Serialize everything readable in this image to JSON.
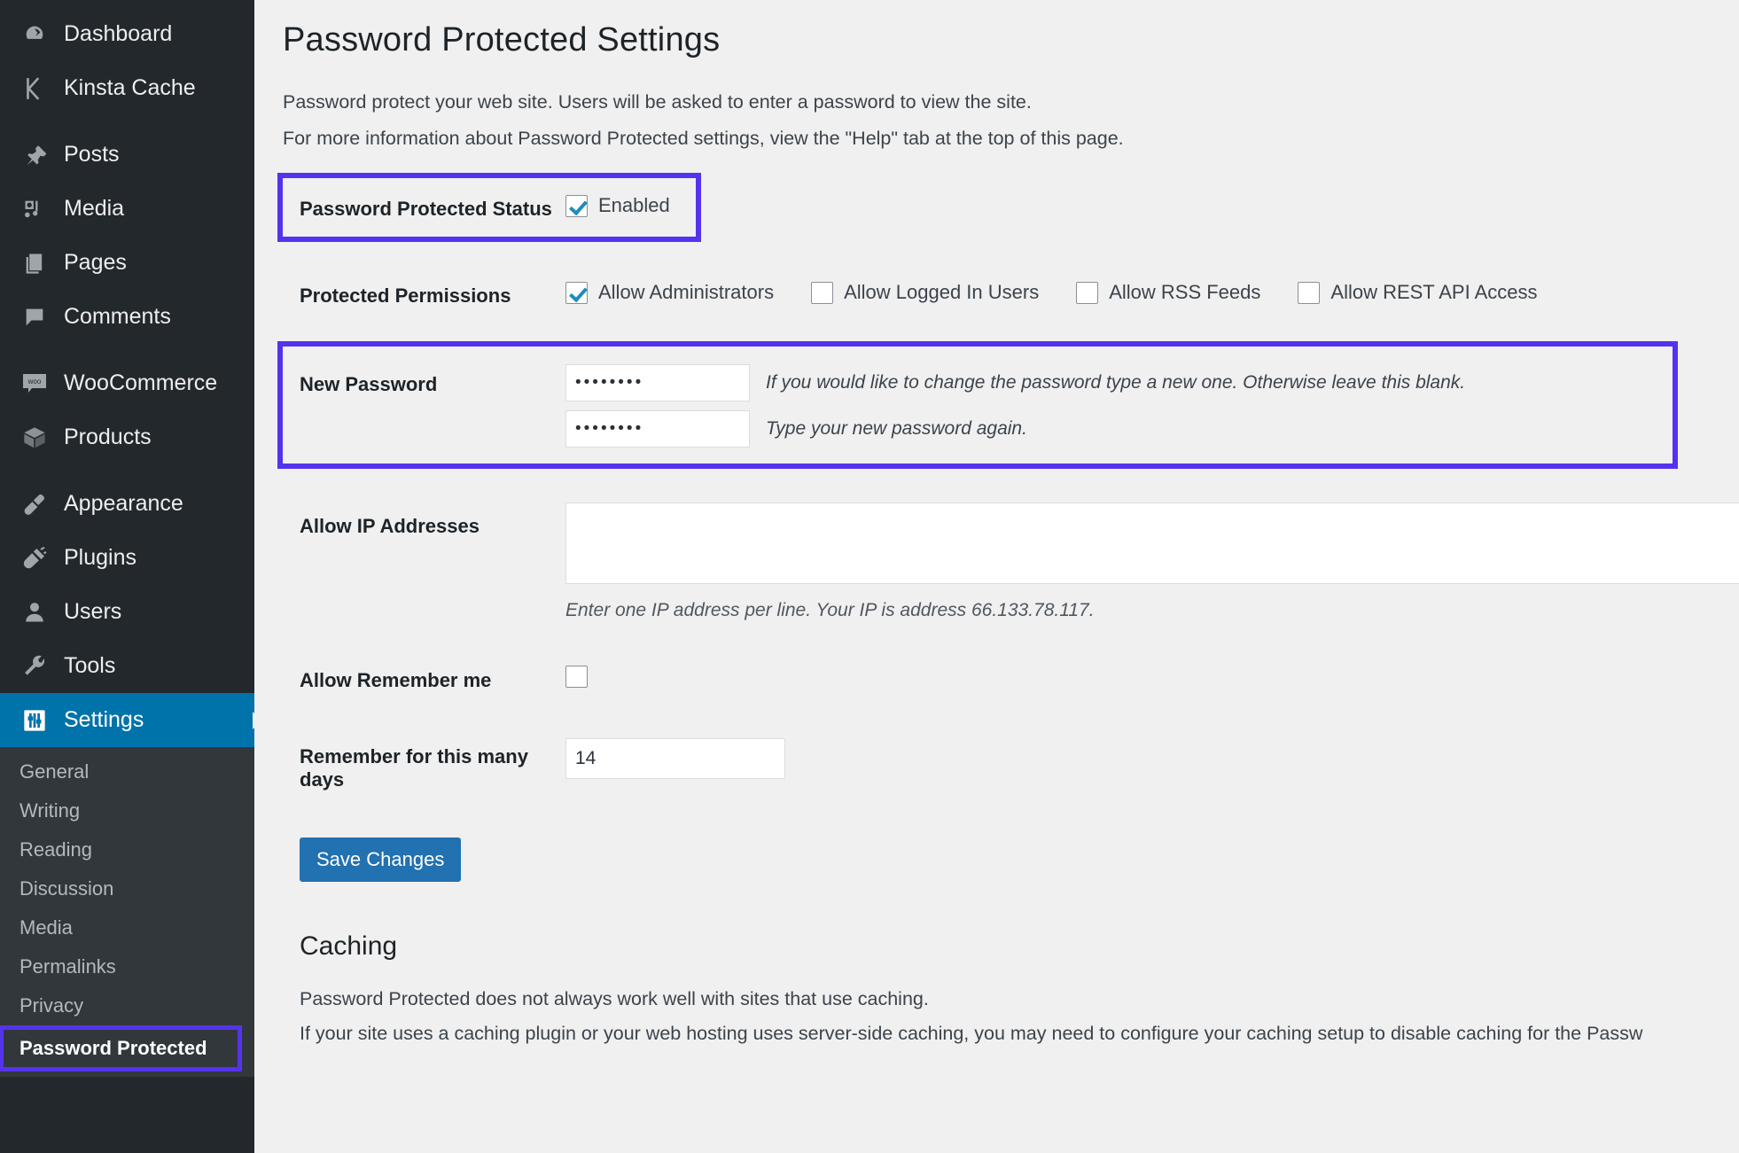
{
  "sidebar": {
    "items": [
      {
        "label": "Dashboard",
        "icon": "dashboard-icon"
      },
      {
        "label": "Kinsta Cache",
        "icon": "kinsta-k-icon"
      },
      {
        "label": "Posts",
        "icon": "pin-icon"
      },
      {
        "label": "Media",
        "icon": "media-icon"
      },
      {
        "label": "Pages",
        "icon": "pages-icon"
      },
      {
        "label": "Comments",
        "icon": "comment-bubble-icon"
      },
      {
        "label": "WooCommerce",
        "icon": "woocommerce-icon"
      },
      {
        "label": "Products",
        "icon": "box-icon"
      },
      {
        "label": "Appearance",
        "icon": "paintbrush-icon"
      },
      {
        "label": "Plugins",
        "icon": "plug-icon"
      },
      {
        "label": "Users",
        "icon": "user-icon"
      },
      {
        "label": "Tools",
        "icon": "wrench-icon"
      },
      {
        "label": "Settings",
        "icon": "settings-sliders-icon"
      }
    ],
    "submenu": [
      {
        "label": "General"
      },
      {
        "label": "Writing"
      },
      {
        "label": "Reading"
      },
      {
        "label": "Discussion"
      },
      {
        "label": "Media"
      },
      {
        "label": "Permalinks"
      },
      {
        "label": "Privacy"
      },
      {
        "label": "Password Protected"
      }
    ]
  },
  "page": {
    "title": "Password Protected Settings",
    "intro_line_1": "Password protect your web site. Users will be asked to enter a password to view the site.",
    "intro_line_2": "For more information about Password Protected settings, view the \"Help\" tab at the top of this page."
  },
  "form": {
    "status": {
      "label": "Password Protected Status",
      "checkbox_label": "Enabled",
      "checked": true
    },
    "permissions": {
      "label": "Protected Permissions",
      "options": [
        {
          "label": "Allow Administrators",
          "checked": true
        },
        {
          "label": "Allow Logged In Users",
          "checked": false
        },
        {
          "label": "Allow RSS Feeds",
          "checked": false
        },
        {
          "label": "Allow REST API Access",
          "checked": false
        }
      ]
    },
    "new_password": {
      "label": "New Password",
      "value_masked": "••••••••",
      "confirm_masked": "••••••••",
      "hint_1": "If you would like to change the password type a new one. Otherwise leave this blank.",
      "hint_2": "Type your new password again."
    },
    "allow_ip": {
      "label": "Allow IP Addresses",
      "value": "",
      "hint": "Enter one IP address per line. Your IP is address 66.133.78.117."
    },
    "remember_me": {
      "label": "Allow Remember me",
      "checked": false
    },
    "remember_days": {
      "label": "Remember for this many days",
      "value": "14"
    },
    "save_button": "Save Changes"
  },
  "caching": {
    "title": "Caching",
    "line_1": "Password Protected does not always work well with sites that use caching.",
    "line_2": "If your site uses a caching plugin or your web hosting uses server-side caching, you may need to configure your caching setup to disable caching for the Passw"
  },
  "colors": {
    "highlight": "#5533ee",
    "sidebar_bg": "#23282d",
    "submenu_bg": "#32373c",
    "active_blue": "#0073aa",
    "button_blue": "#2271b1",
    "checkbox_check": "#1e8cbe"
  }
}
